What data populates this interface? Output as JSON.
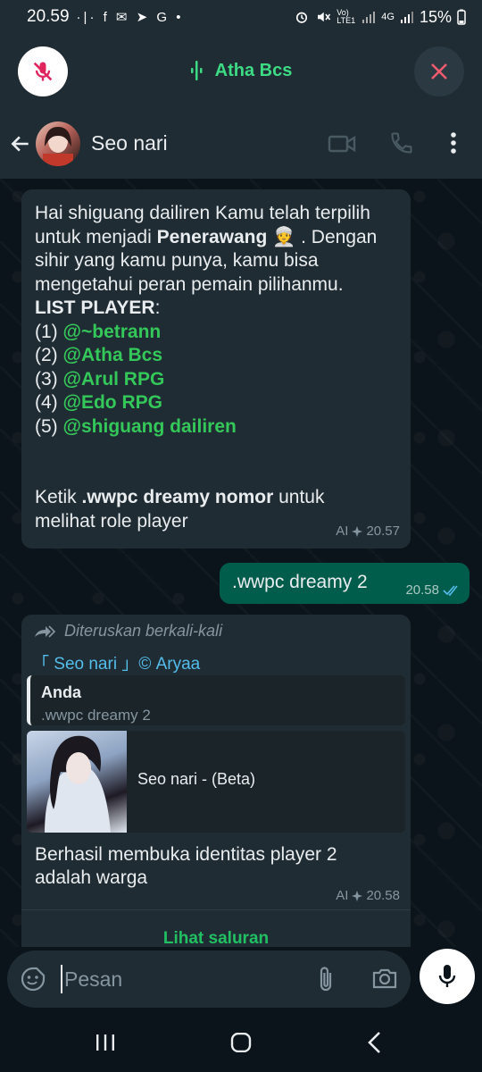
{
  "status_bar": {
    "time": "20.59",
    "left_icons": "·|· f ✉ ➤ G •",
    "network_1": "Vo) LTE1",
    "network_2": "4G",
    "battery": "15%"
  },
  "call_bar": {
    "caller_name": "Atha Bcs",
    "mute_icon": "mic-off-icon",
    "end_icon": "close-icon",
    "accent_color": "#3ddc84"
  },
  "header": {
    "contact_name": "Seo nari"
  },
  "messages": {
    "msg1": {
      "l1": "Hai shiguang dailiren Kamu telah terpilih",
      "l2a": "untuk menjadi ",
      "l2b": "Penerawang",
      "l2c": " 👳 . Dengan",
      "l3": "sihir yang kamu punya, kamu bisa",
      "l4": "mengetahui peran pemain pilihanmu.",
      "l5a": "LIST PLAYER",
      "l5b": ":",
      "players": [
        {
          "num": "(1) ",
          "name": "@~betrann"
        },
        {
          "num": "(2) ",
          "name": "@Atha Bcs"
        },
        {
          "num": "(3) ",
          "name": "@Arul RPG"
        },
        {
          "num": "(4) ",
          "name": "@Edo RPG"
        },
        {
          "num": "(5) ",
          "name": "@shiguang dailiren"
        }
      ],
      "l6a": "Ketik ",
      "l6b": ".wwpc dreamy nomor",
      "l6c": " untuk",
      "l7": "melihat role player",
      "ai_label": "AI",
      "time": "20.57"
    },
    "msg2": {
      "text": ".wwpc dreamy 2",
      "time": "20.58",
      "status": "read"
    },
    "msg3": {
      "forwarded": "Diteruskan berkali-kali",
      "channel": "「 Seo nari 」© Aryaa",
      "quote_title": "Anda",
      "quote_text": ".wwpc dreamy 2",
      "card_title": "Seo nari - (Beta)",
      "text_l1": "Berhasil membuka identitas player 2",
      "text_l2": "adalah warga",
      "ai_label": "AI",
      "time": "20.58",
      "link_label": "Lihat saluran"
    }
  },
  "input": {
    "placeholder": "Pesan"
  },
  "colors": {
    "background": "#0b141a",
    "bar": "#1f2c33",
    "incoming": "#202c33",
    "outgoing": "#005c4b",
    "mention": "#34c759",
    "link": "#53bdeb"
  }
}
